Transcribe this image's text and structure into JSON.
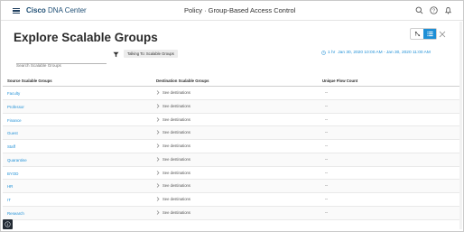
{
  "header": {
    "brand_bold": "Cisco",
    "brand_rest": " DNA Center",
    "page_title": "Policy · Group-Based Access Control",
    "icons": [
      "menu-icon",
      "search-icon",
      "help-icon",
      "notifications-icon"
    ]
  },
  "explore": {
    "title": "Explore Scalable Groups",
    "search_placeholder": "Search Scalable Groups",
    "filter_tag": "Talking To: Scalable Groups",
    "time_period": "1 hr",
    "time_range": "Jan 30, 2020 10:00 AM - Jan 30, 2020 11:00 AM"
  },
  "table": {
    "columns": [
      "Source Scalable Groups",
      "Destination Scalable Groups",
      "Unique Flow Count"
    ],
    "rows": [
      {
        "name": "Faculty",
        "dest": "See destinations",
        "count": "--"
      },
      {
        "name": "Professor",
        "dest": "See destinations",
        "count": "--"
      },
      {
        "name": "Finance",
        "dest": "See destinations",
        "count": "--"
      },
      {
        "name": "Guest",
        "dest": "See destinations",
        "count": "--"
      },
      {
        "name": "Staff",
        "dest": "See destinations",
        "count": "--"
      },
      {
        "name": "Quarantine",
        "dest": "See destinations",
        "count": "--"
      },
      {
        "name": "BYOD",
        "dest": "See destinations",
        "count": "--"
      },
      {
        "name": "HR",
        "dest": "See destinations",
        "count": "--"
      },
      {
        "name": "IT",
        "dest": "See destinations",
        "count": "--"
      },
      {
        "name": "Research",
        "dest": "See destinations",
        "count": "--"
      }
    ]
  },
  "colors": {
    "accent": "#1e8fd6",
    "brand": "#1f4f75"
  }
}
